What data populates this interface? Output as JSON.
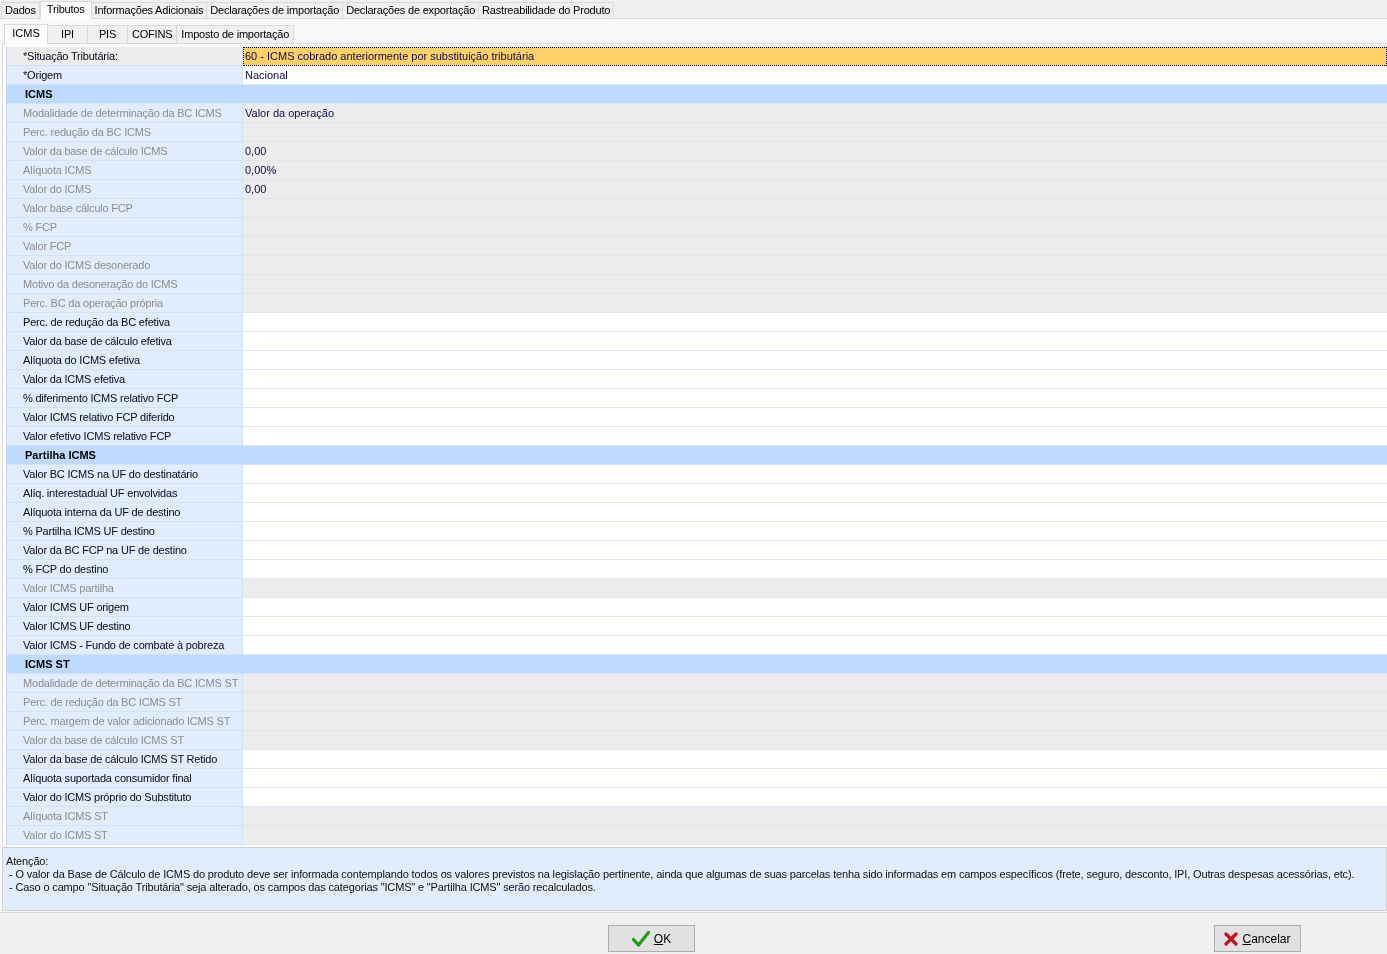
{
  "tabs": [
    {
      "label": "Dados",
      "selected": false
    },
    {
      "label": "Tributos",
      "selected": true
    },
    {
      "label": "Informações Adicionais",
      "selected": false
    },
    {
      "label": "Declarações de importação",
      "selected": false
    },
    {
      "label": "Declarações de exportação",
      "selected": false
    },
    {
      "label": "Rastreabilidade do Produto",
      "selected": false
    }
  ],
  "subtabs": [
    {
      "label": "ICMS",
      "selected": true
    },
    {
      "label": "IPI",
      "selected": false
    },
    {
      "label": "PIS",
      "selected": false
    },
    {
      "label": "COFINS",
      "selected": false
    },
    {
      "label": "Imposto de importação",
      "selected": false
    }
  ],
  "grid": {
    "rows": [
      {
        "kind": "field",
        "label": "*Situação Tributária:",
        "value": "60 - ICMS cobrado anteriormente por substituição tributária",
        "disabled": false,
        "selected": true
      },
      {
        "kind": "field",
        "label": "*Origem",
        "value": "Nacional",
        "disabled": false,
        "selected": false
      },
      {
        "kind": "section",
        "label": "ICMS"
      },
      {
        "kind": "field",
        "label": "Modalidade de determinação da BC ICMS",
        "value": "Valor da operação",
        "disabled": true,
        "selected": false
      },
      {
        "kind": "field",
        "label": "Perc. redução da BC ICMS",
        "disabled": true,
        "selected": false
      },
      {
        "kind": "field",
        "label": "Valor da base de cálculo ICMS",
        "value": "0,00",
        "disabled": true,
        "selected": false
      },
      {
        "kind": "field",
        "label": "Alíquota ICMS",
        "value": "0,00%",
        "disabled": true,
        "selected": false
      },
      {
        "kind": "field",
        "label": "Valor do ICMS",
        "value": "0,00",
        "disabled": true,
        "selected": false
      },
      {
        "kind": "field",
        "label": "Valor base cálculo FCP",
        "disabled": true,
        "selected": false
      },
      {
        "kind": "field",
        "label": "% FCP",
        "disabled": true,
        "selected": false
      },
      {
        "kind": "field",
        "label": "Valor FCP",
        "disabled": true,
        "selected": false
      },
      {
        "kind": "field",
        "label": "Valor do ICMS desonerado",
        "disabled": true,
        "selected": false
      },
      {
        "kind": "field",
        "label": "Motivo da desoneração do ICMS",
        "disabled": true,
        "selected": false
      },
      {
        "kind": "field",
        "label": "Perc. BC da operação própria",
        "disabled": true,
        "selected": false
      },
      {
        "kind": "field",
        "label": "Perc. de redução da BC efetiva",
        "disabled": false,
        "selected": false
      },
      {
        "kind": "field",
        "label": "Valor da base de cálculo efetiva",
        "disabled": false,
        "selected": false
      },
      {
        "kind": "field",
        "label": "Alíquota do ICMS efetiva",
        "disabled": false,
        "selected": false
      },
      {
        "kind": "field",
        "label": "Valor da ICMS efetiva",
        "disabled": false,
        "selected": false
      },
      {
        "kind": "field",
        "label": "% diferimento ICMS relativo FCP",
        "disabled": false,
        "selected": false
      },
      {
        "kind": "field",
        "label": "Valor ICMS relativo FCP diferido",
        "disabled": false,
        "selected": false
      },
      {
        "kind": "field",
        "label": "Valor efetivo ICMS relativo FCP",
        "disabled": false,
        "selected": false
      },
      {
        "kind": "section",
        "label": "Partilha ICMS"
      },
      {
        "kind": "field",
        "label": "Valor BC ICMS na UF do destinatário",
        "disabled": false,
        "selected": false
      },
      {
        "kind": "field",
        "label": "Alíq. interestadual UF envolvidas",
        "disabled": false,
        "selected": false
      },
      {
        "kind": "field",
        "label": "Alíquota interna da UF de destino",
        "disabled": false,
        "selected": false
      },
      {
        "kind": "field",
        "label": "% Partilha ICMS UF destino",
        "disabled": false,
        "selected": false
      },
      {
        "kind": "field",
        "label": "Valor da BC FCP na UF de destino",
        "disabled": false,
        "selected": false
      },
      {
        "kind": "field",
        "label": "% FCP do destino",
        "disabled": false,
        "selected": false
      },
      {
        "kind": "field",
        "label": "Valor ICMS partilha",
        "disabled": true,
        "selected": false
      },
      {
        "kind": "field",
        "label": "Valor ICMS UF origem",
        "disabled": false,
        "selected": false
      },
      {
        "kind": "field",
        "label": "Valor ICMS UF destino",
        "disabled": false,
        "selected": false
      },
      {
        "kind": "field",
        "label": "Valor ICMS - Fundo de combate à pobreza",
        "disabled": false,
        "selected": false
      },
      {
        "kind": "section",
        "label": "ICMS ST"
      },
      {
        "kind": "field",
        "label": "Modalidade de determinação da BC ICMS ST",
        "disabled": true,
        "selected": false
      },
      {
        "kind": "field",
        "label": "Perc. de redução da BC ICMS ST",
        "disabled": true,
        "selected": false
      },
      {
        "kind": "field",
        "label": "Perc. margem de valor adicionado ICMS ST",
        "disabled": true,
        "selected": false
      },
      {
        "kind": "field",
        "label": "Valor da base de cálculo ICMS ST",
        "disabled": true,
        "selected": false
      },
      {
        "kind": "field",
        "label": "Valor da base de cálculo ICMS ST Retido",
        "disabled": false,
        "selected": false
      },
      {
        "kind": "field",
        "label": "Alíquota suportada consumidor final",
        "disabled": false,
        "selected": false
      },
      {
        "kind": "field",
        "label": "Valor do ICMS próprio do Substituto",
        "disabled": false,
        "selected": false
      },
      {
        "kind": "field",
        "label": "Alíquota ICMS ST",
        "disabled": true,
        "selected": false
      },
      {
        "kind": "field",
        "label": "Valor do ICMS ST",
        "disabled": true,
        "selected": false
      }
    ]
  },
  "notes": {
    "title": "Atenção:",
    "lines": [
      "- O valor da Base de Cálculo de ICMS do produto deve ser informada contemplando todos os valores previstos na legislação pertinente, ainda que algumas de suas parcelas tenha sido informadas em campos específicos (frete, seguro, desconto, IPI, Outras despesas acessórias, etc).",
      "- Caso o campo \"Situação Tributária\" seja alterado, os campos das categorias \"ICMS\" e \"Partilha ICMS\" serão recalculados."
    ]
  },
  "buttons": [
    {
      "kind": "confirm",
      "label": "OK"
    },
    {
      "kind": "cancel",
      "label": "Cancelar"
    }
  ]
}
